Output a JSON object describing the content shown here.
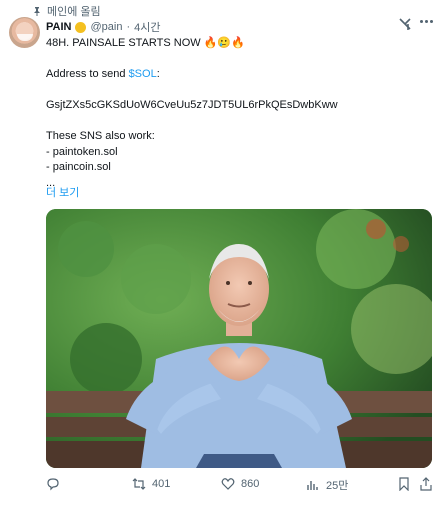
{
  "pinned_label": "메인에 올림",
  "author": {
    "name": "PAIN",
    "handle": "@pain",
    "separator": "·",
    "time": "4시간"
  },
  "tweet": {
    "line1": "48H. PAINSALE STARTS NOW 🔥🥲🔥",
    "address_prefix": "Address to send ",
    "cashtag": "$SOL",
    "address_suffix": ":",
    "address": "GsjtZXs5cGKSdUoW6CveUu5z7JDT5UL6rPkQEsDwbKww",
    "sns_intro": "These SNS also work:",
    "sns_1": "- paintoken.sol",
    "sns_2": "- paincoin.sol",
    "ellipsis": "...",
    "show_more": "더 보기"
  },
  "actions": {
    "reply_count": "",
    "retweet_count": "401",
    "like_count": "860",
    "views_count": "25만"
  },
  "icons": [
    "pin-icon",
    "verified-badge-icon",
    "grok-icon",
    "more-icon",
    "reply-icon",
    "retweet-icon",
    "like-icon",
    "views-icon",
    "bookmark-icon",
    "share-icon"
  ],
  "colors": {
    "link": "#1d9bf0",
    "muted": "#536471",
    "text": "#0f1419"
  }
}
